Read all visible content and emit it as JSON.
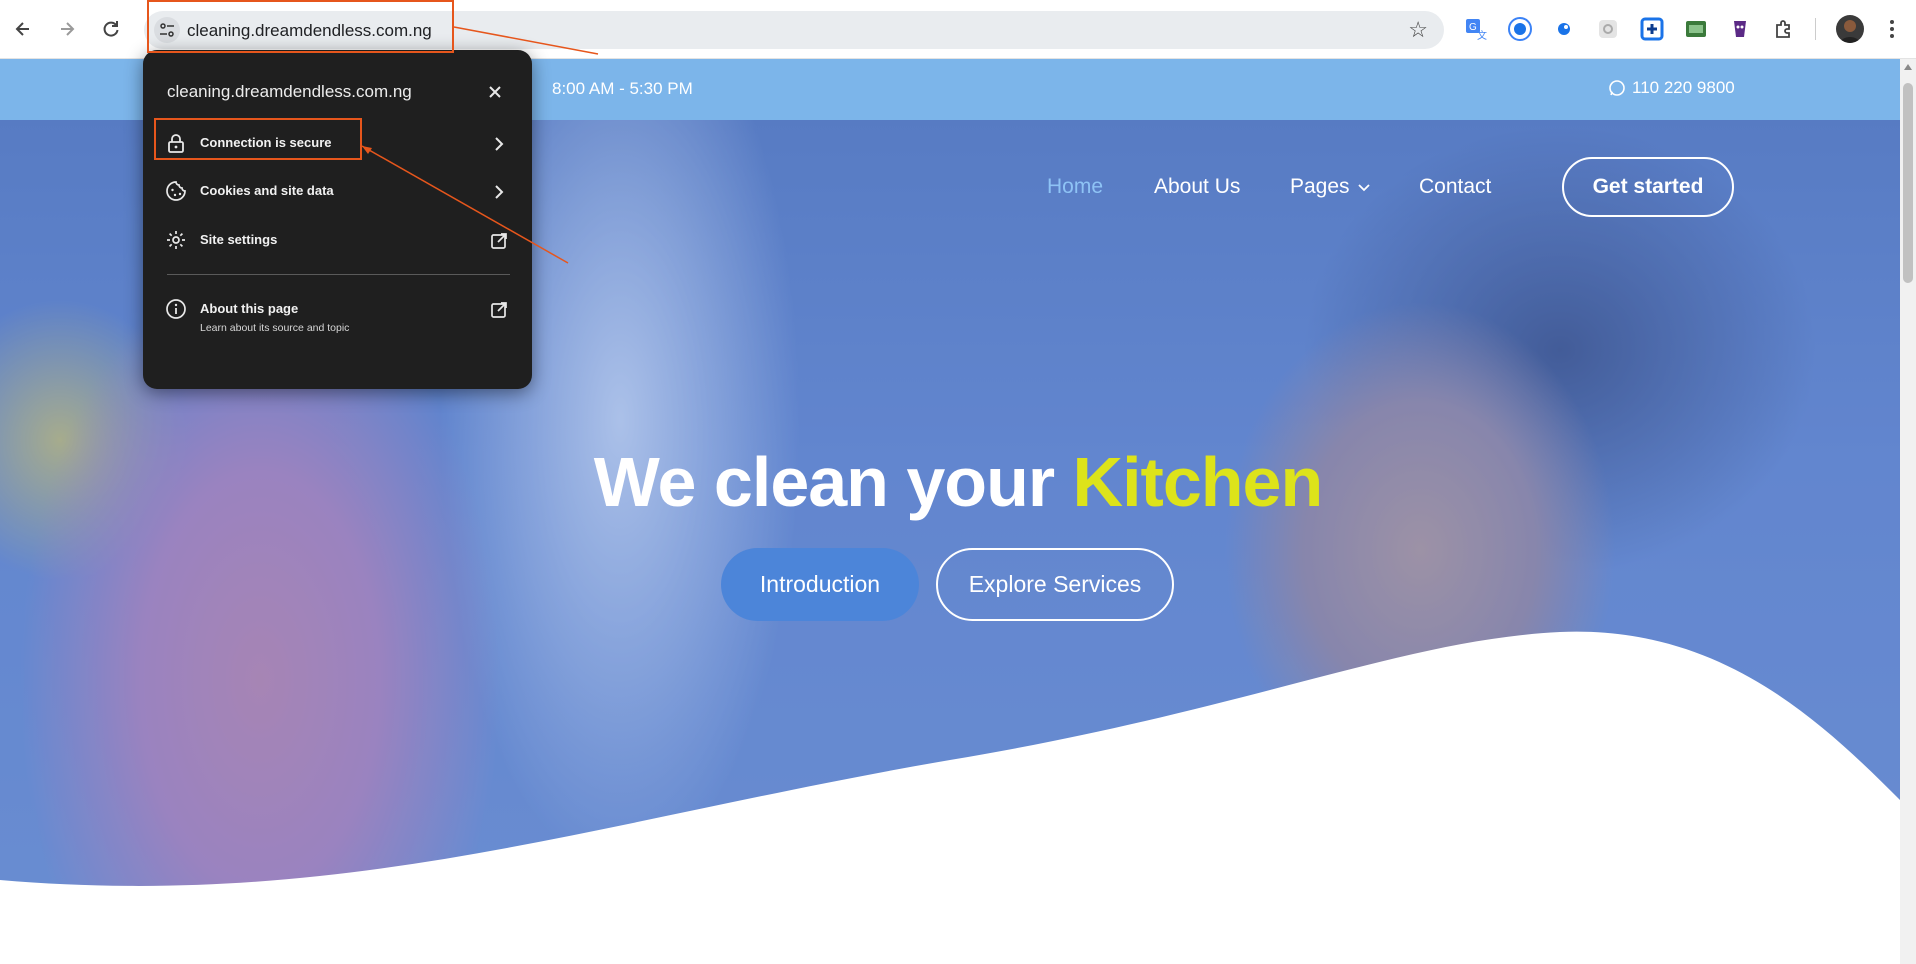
{
  "browser": {
    "url": "cleaning.dreamdendless.com.ng",
    "extensions": [
      "translate-icon",
      "extension-blue-circle-icon",
      "extension-blue-dot-icon",
      "extension-gray-icon",
      "extension-blue-square-icon",
      "extension-green-icon",
      "extension-purple-icon",
      "puzzle-icon"
    ]
  },
  "site_info_popup": {
    "domain": "cleaning.dreamdendless.com.ng",
    "items": [
      {
        "label": "Connection is secure",
        "icon": "lock-icon"
      },
      {
        "label": "Cookies and site data",
        "icon": "cookie-icon"
      },
      {
        "label": "Site settings",
        "icon": "gear-icon"
      },
      {
        "label": "About this page",
        "sublabel": "Learn about its source and topic",
        "icon": "info-icon"
      }
    ]
  },
  "website": {
    "topbar": {
      "hours": "8:00 AM - 5:30 PM",
      "phone": "110 220 9800"
    },
    "nav": {
      "home": "Home",
      "about": "About Us",
      "pages": "Pages",
      "contact": "Contact",
      "cta": "Get started"
    },
    "hero": {
      "headline": "We clean your",
      "headline_accent": "Kitchen",
      "btn_primary": "Introduction",
      "btn_secondary": "Explore Services"
    }
  },
  "colors": {
    "topbar": "#7cb5ea",
    "accent_yellow": "#dde31a",
    "primary_button": "#4c85d9",
    "highlight": "#e6561c"
  }
}
